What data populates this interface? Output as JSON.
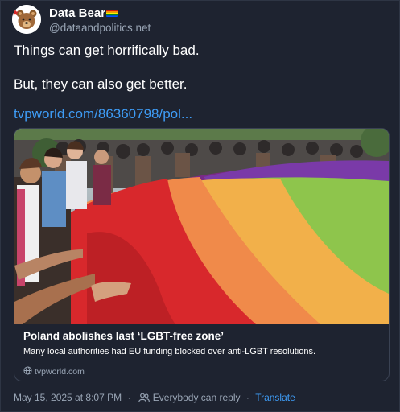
{
  "author": {
    "display_name": "Data Bear",
    "handle": "@dataandpolitics.net",
    "avatar_icon": "bear-avatar-icon",
    "name_badge_icon": "rainbow-flag-icon"
  },
  "post": {
    "line1": "Things can get horrifically bad.",
    "line2": "But, they can also get better.",
    "link": "tvpworld.com/86360798/pol..."
  },
  "link_card": {
    "image_icon": "rainbow-flag-crowd-photo",
    "title": "Poland abolishes last ‘LGBT-free zone’",
    "description": "Many local authorities had EU funding blocked over anti-LGBT resolutions.",
    "domain": "tvpworld.com",
    "domain_icon": "globe-icon"
  },
  "meta": {
    "timestamp": "May 15, 2025 at 8:07 PM",
    "separator": "·",
    "reply_setting": "Everybody can reply",
    "reply_icon": "people-icon",
    "translate": "Translate"
  },
  "colors": {
    "background": "#1e2330",
    "link": "#3e9cf6",
    "muted": "#9aa6b6",
    "border": "#3a4253"
  }
}
